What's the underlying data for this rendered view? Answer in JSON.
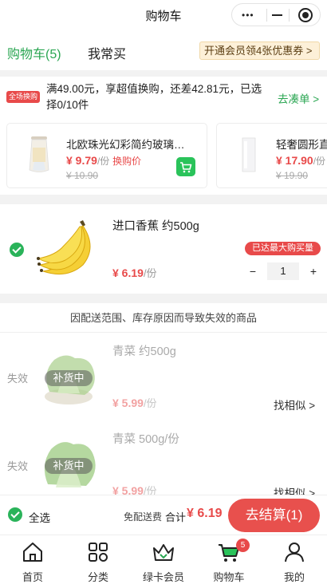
{
  "nav": {
    "title": "购物车",
    "more_icon": "•••"
  },
  "tabs": {
    "cart": "购物车(5)",
    "frequent": "我常买",
    "member_promo": "开通会员领4张优惠券 >"
  },
  "promo": {
    "badge": "全场换购",
    "text": "满49.00元，享超值换购，还差42.81元，已选择0/10件",
    "link": "去凑单 >",
    "products": [
      {
        "name": "北欧珠光幻彩简约玻璃花瓶",
        "price": "¥ 9.79",
        "unit": "/份",
        "tag": "换购价",
        "old_price": "¥ 10.90"
      },
      {
        "name": "轻奢圆形直筒玻璃花瓶",
        "price": "¥ 17.90",
        "unit": "/份",
        "tag": "",
        "old_price": "¥ 19.90"
      }
    ]
  },
  "item": {
    "name": "进口香蕉 约500g",
    "price": "¥ 6.19",
    "unit": "/份",
    "limit_tag": "已达最大购买量",
    "quantity": "1",
    "minus": "−",
    "plus": "+"
  },
  "invalid": {
    "header": "因配送范围、库存原因而导致失效的商品",
    "items": [
      {
        "status": "失效",
        "overlay": "补货中",
        "name": "青菜 约500g",
        "price": "¥ 5.99",
        "unit": "/份",
        "similar": "找相似 >"
      },
      {
        "status": "失效",
        "overlay": "补货中",
        "name": "青菜 500g/份",
        "price": "¥ 5.99",
        "unit": "/份",
        "similar": "找相似 >"
      }
    ]
  },
  "checkout": {
    "select_all": "全选",
    "free_shipping": "免配送费",
    "total_label": "合计",
    "total_value": "¥ 6.19",
    "pay_button": "去结算(1)"
  },
  "tabbar": [
    {
      "label": "首页",
      "icon": "home-icon"
    },
    {
      "label": "分类",
      "icon": "category-icon"
    },
    {
      "label": "绿卡会员",
      "icon": "crown-icon"
    },
    {
      "label": "购物车",
      "icon": "cart-icon",
      "badge": "5"
    },
    {
      "label": "我的",
      "icon": "user-icon"
    }
  ],
  "colors": {
    "brand_green": "#2aa652",
    "price_red": "#e84a4a",
    "pay_button": "#e8504d"
  }
}
